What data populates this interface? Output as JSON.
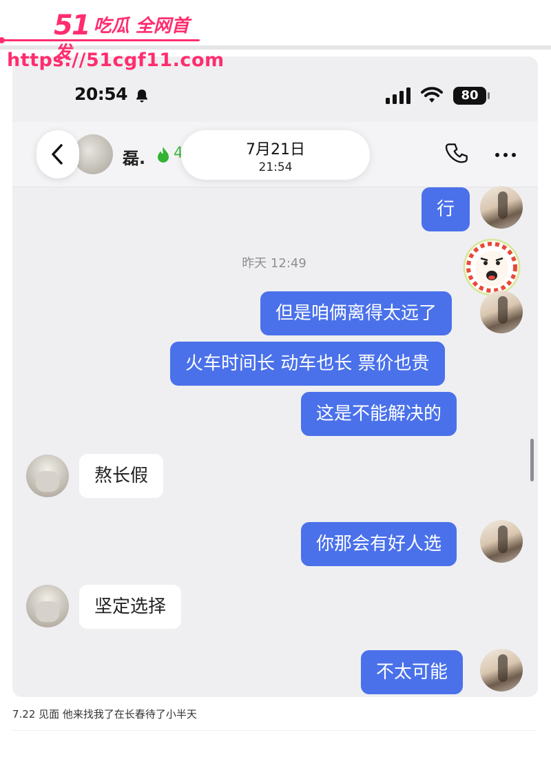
{
  "watermark": {
    "logo_num": "51",
    "logo_text": "吃瓜 全网首发",
    "url": "https://51cgf11.com"
  },
  "status_bar": {
    "time": "20:54",
    "battery": "80",
    "icons": [
      "bell-icon",
      "signal-icon",
      "wifi-icon",
      "battery-icon"
    ]
  },
  "header": {
    "contact_name": "磊.",
    "streak": "4",
    "date": "7月21日",
    "time": "21:54",
    "icons": [
      "back-chevron-icon",
      "flame-icon",
      "phone-icon",
      "more-icon"
    ]
  },
  "messages": [
    {
      "side": "out",
      "text": "行"
    },
    {
      "type": "timestamp",
      "text": "昨天 12:49"
    },
    {
      "side": "out",
      "text": "但是咱俩离得太远了"
    },
    {
      "side": "out",
      "text": "火车时间长 动车也长 票价也贵"
    },
    {
      "side": "out",
      "text": "这是不能解决的"
    },
    {
      "side": "in",
      "text": "熬长假"
    },
    {
      "side": "out",
      "text": "你那会有好人选"
    },
    {
      "side": "in",
      "text": "坚定选择"
    },
    {
      "side": "out",
      "text": "不太可能"
    }
  ],
  "caption": "7.22 见面 他来找我了在长春待了小半天",
  "colors": {
    "outgoing_bubble": "#4a71ea",
    "incoming_bubble": "#ffffff",
    "chat_background": "#efeff2",
    "watermark": "#ff2d6e"
  }
}
